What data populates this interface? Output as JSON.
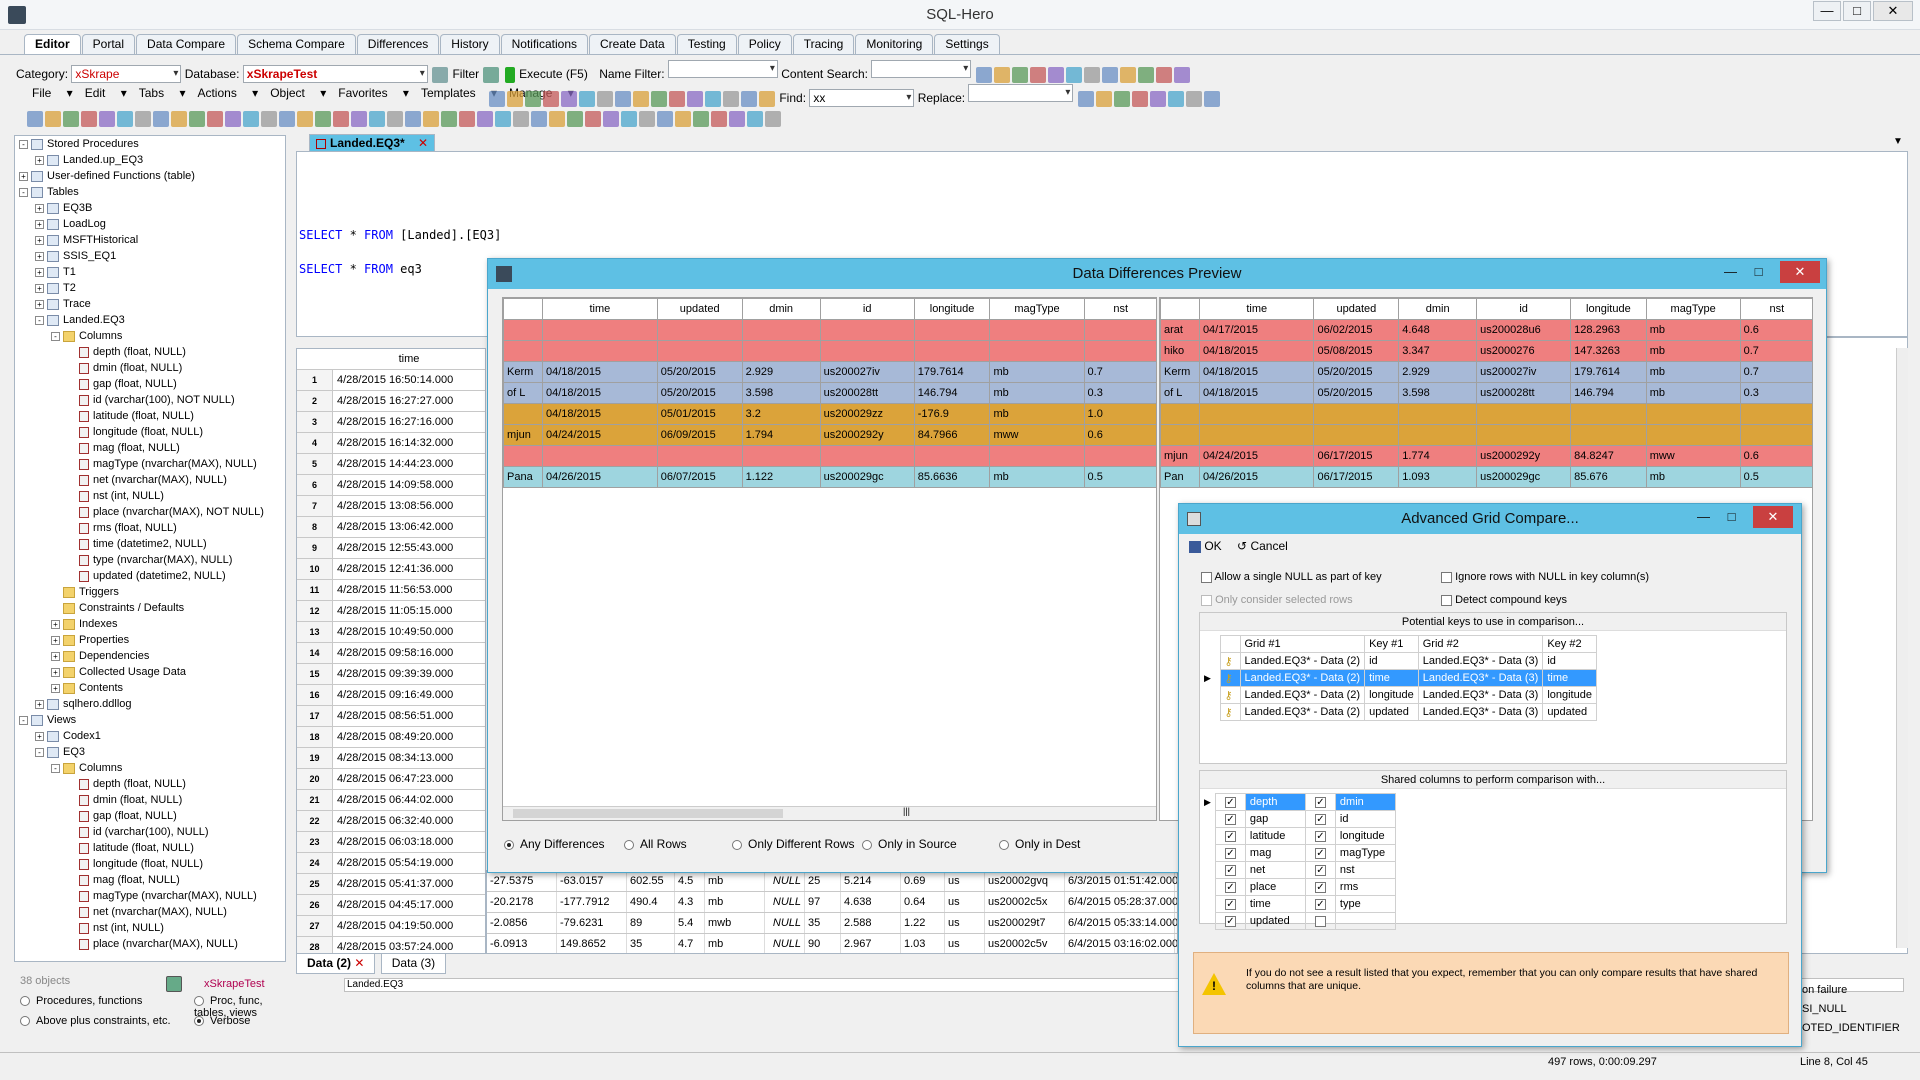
{
  "app": {
    "title": "SQL-Hero"
  },
  "tabs": [
    "Editor",
    "Portal",
    "Data Compare",
    "Schema Compare",
    "Differences",
    "History",
    "Notifications",
    "Create Data",
    "Testing",
    "Policy",
    "Tracing",
    "Monitoring",
    "Settings"
  ],
  "toolbar": {
    "category_label": "Category:",
    "category_value": "xSkrape",
    "database_label": "Database:",
    "database_value": "xSkrapeTest",
    "filter_label": "Filter",
    "execute_label": "Execute (F5)",
    "name_filter_label": "Name Filter:",
    "content_search_label": "Content Search:",
    "find_label": "Find:",
    "find_value": "xx",
    "replace_label": "Replace:"
  },
  "menu": [
    "File",
    "Edit",
    "Tabs",
    "Actions",
    "Object",
    "Favorites",
    "Templates",
    "Manage"
  ],
  "tree": [
    {
      "d": 0,
      "e": "-",
      "i": "db",
      "t": "Stored Procedures"
    },
    {
      "d": 1,
      "e": "+",
      "i": "db",
      "t": "Landed.up_EQ3"
    },
    {
      "d": 0,
      "e": "+",
      "i": "fx",
      "t": "User-defined Functions (table)"
    },
    {
      "d": 0,
      "e": "-",
      "i": "db",
      "t": "Tables"
    },
    {
      "d": 1,
      "e": "+",
      "i": "db",
      "t": "EQ3B"
    },
    {
      "d": 1,
      "e": "+",
      "i": "db",
      "t": "LoadLog"
    },
    {
      "d": 1,
      "e": "+",
      "i": "db",
      "t": "MSFTHistorical"
    },
    {
      "d": 1,
      "e": "+",
      "i": "db",
      "t": "SSIS_EQ1"
    },
    {
      "d": 1,
      "e": "+",
      "i": "db",
      "t": "T1"
    },
    {
      "d": 1,
      "e": "+",
      "i": "db",
      "t": "T2"
    },
    {
      "d": 1,
      "e": "+",
      "i": "db",
      "t": "Trace"
    },
    {
      "d": 1,
      "e": "-",
      "i": "db",
      "t": "Landed.EQ3"
    },
    {
      "d": 2,
      "e": "-",
      "i": "folder",
      "t": "Columns"
    },
    {
      "d": 3,
      "e": "",
      "i": "col",
      "t": "depth (float, NULL)"
    },
    {
      "d": 3,
      "e": "",
      "i": "col",
      "t": "dmin (float, NULL)"
    },
    {
      "d": 3,
      "e": "",
      "i": "col",
      "t": "gap (float, NULL)"
    },
    {
      "d": 3,
      "e": "",
      "i": "col",
      "t": "id (varchar(100), NOT NULL)"
    },
    {
      "d": 3,
      "e": "",
      "i": "col",
      "t": "latitude (float, NULL)"
    },
    {
      "d": 3,
      "e": "",
      "i": "col",
      "t": "longitude (float, NULL)"
    },
    {
      "d": 3,
      "e": "",
      "i": "col",
      "t": "mag (float, NULL)"
    },
    {
      "d": 3,
      "e": "",
      "i": "col",
      "t": "magType (nvarchar(MAX), NULL)"
    },
    {
      "d": 3,
      "e": "",
      "i": "col",
      "t": "net (nvarchar(MAX), NULL)"
    },
    {
      "d": 3,
      "e": "",
      "i": "col",
      "t": "nst (int, NULL)"
    },
    {
      "d": 3,
      "e": "",
      "i": "col",
      "t": "place (nvarchar(MAX), NOT NULL)"
    },
    {
      "d": 3,
      "e": "",
      "i": "col",
      "t": "rms (float, NULL)"
    },
    {
      "d": 3,
      "e": "",
      "i": "col",
      "t": "time (datetime2, NULL)"
    },
    {
      "d": 3,
      "e": "",
      "i": "col",
      "t": "type (nvarchar(MAX), NULL)"
    },
    {
      "d": 3,
      "e": "",
      "i": "col",
      "t": "updated (datetime2, NULL)"
    },
    {
      "d": 2,
      "e": "",
      "i": "folder",
      "t": "Triggers"
    },
    {
      "d": 2,
      "e": "",
      "i": "folder",
      "t": "Constraints / Defaults"
    },
    {
      "d": 2,
      "e": "+",
      "i": "folder",
      "t": "Indexes"
    },
    {
      "d": 2,
      "e": "+",
      "i": "folder",
      "t": "Properties"
    },
    {
      "d": 2,
      "e": "+",
      "i": "folder",
      "t": "Dependencies"
    },
    {
      "d": 2,
      "e": "+",
      "i": "folder",
      "t": "Collected Usage Data"
    },
    {
      "d": 2,
      "e": "+",
      "i": "folder",
      "t": "Contents"
    },
    {
      "d": 1,
      "e": "+",
      "i": "db",
      "t": "sqlhero.ddllog"
    },
    {
      "d": 0,
      "e": "-",
      "i": "db",
      "t": "Views"
    },
    {
      "d": 1,
      "e": "+",
      "i": "db",
      "t": "Codex1"
    },
    {
      "d": 1,
      "e": "-",
      "i": "db",
      "t": "EQ3"
    },
    {
      "d": 2,
      "e": "-",
      "i": "folder",
      "t": "Columns"
    },
    {
      "d": 3,
      "e": "",
      "i": "col",
      "t": "depth (float, NULL)"
    },
    {
      "d": 3,
      "e": "",
      "i": "col",
      "t": "dmin (float, NULL)"
    },
    {
      "d": 3,
      "e": "",
      "i": "col",
      "t": "gap (float, NULL)"
    },
    {
      "d": 3,
      "e": "",
      "i": "col",
      "t": "id (varchar(100), NULL)"
    },
    {
      "d": 3,
      "e": "",
      "i": "col",
      "t": "latitude (float, NULL)"
    },
    {
      "d": 3,
      "e": "",
      "i": "col",
      "t": "longitude (float, NULL)"
    },
    {
      "d": 3,
      "e": "",
      "i": "col",
      "t": "mag (float, NULL)"
    },
    {
      "d": 3,
      "e": "",
      "i": "col",
      "t": "magType (nvarchar(MAX), NULL)"
    },
    {
      "d": 3,
      "e": "",
      "i": "col",
      "t": "net (nvarchar(MAX), NULL)"
    },
    {
      "d": 3,
      "e": "",
      "i": "col",
      "t": "nst (int, NULL)"
    },
    {
      "d": 3,
      "e": "",
      "i": "col",
      "t": "place (nvarchar(MAX), NULL)"
    }
  ],
  "tree_footer": {
    "count": "38 objects",
    "db": "xSkrapeTest",
    "opt1": "Procedures, functions",
    "opt2": "Proc, func, tables, views",
    "opt3": "Above plus constraints, etc.",
    "opt4": "Verbose"
  },
  "editor": {
    "tab": "Landed.EQ3*",
    "line1_kw": "SELECT",
    "line1_rest": " * ",
    "line1_kw2": "FROM",
    "line1_obj": " [Landed].[EQ3]",
    "line2_kw": "SELECT",
    "line2_rest": " * ",
    "line2_kw2": "FROM",
    "line2_obj": " eq3"
  },
  "results": {
    "header": "time",
    "rows": [
      "4/28/2015 16:50:14.000",
      "4/28/2015 16:27:27.000",
      "4/28/2015 16:27:16.000",
      "4/28/2015 16:14:32.000",
      "4/28/2015 14:44:23.000",
      "4/28/2015 14:09:58.000",
      "4/28/2015 13:08:56.000",
      "4/28/2015 13:06:42.000",
      "4/28/2015 12:55:43.000",
      "4/28/2015 12:41:36.000",
      "4/28/2015 11:56:53.000",
      "4/28/2015 11:05:15.000",
      "4/28/2015 10:49:50.000",
      "4/28/2015 09:58:16.000",
      "4/28/2015 09:39:39.000",
      "4/28/2015 09:16:49.000",
      "4/28/2015 08:56:51.000",
      "4/28/2015 08:49:20.000",
      "4/28/2015 08:34:13.000",
      "4/28/2015 06:47:23.000",
      "4/28/2015 06:44:02.000",
      "4/28/2015 06:32:40.000",
      "4/28/2015 06:03:18.000",
      "4/28/2015 05:54:19.000",
      "4/28/2015 05:41:37.000",
      "4/28/2015 04:45:17.000",
      "4/28/2015 04:19:50.000",
      "4/28/2015 03:57:24.000"
    ],
    "extra": [
      [
        "-27.5375",
        "-63.0157",
        "602.55",
        "4.5",
        "mb",
        "NULL",
        "25",
        "5.214",
        "0.69",
        "us",
        "us20002gvq",
        "6/3/2015 01:51:42.000"
      ],
      [
        "-20.2178",
        "-177.7912",
        "490.4",
        "4.3",
        "mb",
        "NULL",
        "97",
        "4.638",
        "0.64",
        "us",
        "us20002c5x",
        "6/4/2015 05:28:37.000"
      ],
      [
        "-2.0856",
        "-79.6231",
        "89",
        "5.4",
        "mwb",
        "NULL",
        "35",
        "2.588",
        "1.22",
        "us",
        "us200029t7",
        "6/4/2015 05:33:14.000"
      ],
      [
        "-6.0913",
        "149.8652",
        "35",
        "4.7",
        "mb",
        "NULL",
        "90",
        "2.967",
        "1.03",
        "us",
        "us20002c5v",
        "6/4/2015 03:16:02.000"
      ]
    ],
    "tabs": [
      "Data (2)",
      "Data (3)"
    ],
    "source": "Landed.EQ3"
  },
  "diff": {
    "title": "Data Differences Preview",
    "left_cols": [
      "",
      "time",
      "updated",
      "dmin",
      "id",
      "longitude",
      "magType",
      "nst"
    ],
    "right_cols": [
      "",
      "time",
      "updated",
      "dmin",
      "id",
      "longitude",
      "magType",
      "nst"
    ],
    "rows": [
      {
        "c": "red",
        "l": [
          "",
          "",
          "",
          "",
          "",
          "",
          "",
          ""
        ],
        "r": [
          "arat",
          "04/17/2015",
          "06/02/2015",
          "4.648",
          "us200028u6",
          "128.2963",
          "mb",
          "0.6"
        ]
      },
      {
        "c": "red",
        "l": [
          "",
          "",
          "",
          "",
          "",
          "",
          "",
          ""
        ],
        "r": [
          "hiko",
          "04/18/2015",
          "05/08/2015",
          "3.347",
          "us2000276",
          "147.3263",
          "mb",
          "0.7"
        ]
      },
      {
        "c": "blue",
        "l": [
          "Kerm",
          "04/18/2015",
          "05/20/2015",
          "2.929",
          "us200027iv",
          "179.7614",
          "mb",
          "0.7"
        ],
        "r": [
          "Kerm",
          "04/18/2015",
          "05/20/2015",
          "2.929",
          "us200027iv",
          "179.7614",
          "mb",
          "0.7"
        ]
      },
      {
        "c": "blue",
        "l": [
          "of L",
          "04/18/2015",
          "05/20/2015",
          "3.598",
          "us200028tt",
          "146.794",
          "mb",
          "0.3"
        ],
        "r": [
          "of L",
          "04/18/2015",
          "05/20/2015",
          "3.598",
          "us200028tt",
          "146.794",
          "mb",
          "0.3"
        ]
      },
      {
        "c": "orange",
        "l": [
          "",
          "04/18/2015",
          "05/01/2015",
          "3.2",
          "us200029zz",
          "-176.9",
          "mb",
          "1.0"
        ],
        "r": [
          "",
          "",
          "",
          "",
          "",
          "",
          "",
          ""
        ]
      },
      {
        "c": "orange",
        "l": [
          "mjun",
          "04/24/2015",
          "06/09/2015",
          "1.794",
          "us2000292y",
          "84.7966",
          "mww",
          "0.6"
        ],
        "r": [
          "",
          "",
          "",
          "",
          "",
          "",
          "",
          ""
        ]
      },
      {
        "c": "red",
        "l": [
          "",
          "",
          "",
          "",
          "",
          "",
          "",
          ""
        ],
        "r": [
          "mjun",
          "04/24/2015",
          "06/17/2015",
          "1.774",
          "us2000292y",
          "84.8247",
          "mww",
          "0.6"
        ]
      },
      {
        "c": "cyan",
        "l": [
          "Pana",
          "04/26/2015",
          "06/07/2015",
          "1.122",
          "us200029gc",
          "85.6636",
          "mb",
          "0.5"
        ],
        "r": [
          "Pan",
          "04/26/2015",
          "06/17/2015",
          "1.093",
          "us200029gc",
          "85.676",
          "mb",
          "0.5"
        ]
      }
    ],
    "radios": [
      "Any Differences",
      "All Rows",
      "Only Different Rows",
      "Only in Source",
      "Only in Dest"
    ]
  },
  "agc": {
    "title": "Advanced Grid Compare...",
    "ok": "OK",
    "cancel": "Cancel",
    "opt1": "Allow a single NULL as part of key",
    "opt2": "Ignore rows with NULL in key column(s)",
    "opt3": "Only consider selected rows",
    "opt4": "Detect compound keys",
    "keys_title": "Potential keys to use in comparison...",
    "keys_cols": [
      "Grid #1",
      "Key #1",
      "Grid #2",
      "Key #2"
    ],
    "keys": [
      [
        "Landed.EQ3* - Data (2)",
        "id",
        "Landed.EQ3* - Data (3)",
        "id"
      ],
      [
        "Landed.EQ3* - Data (2)",
        "time",
        "Landed.EQ3* - Data (3)",
        "time"
      ],
      [
        "Landed.EQ3* - Data (2)",
        "longitude",
        "Landed.EQ3* - Data (3)",
        "longitude"
      ],
      [
        "Landed.EQ3* - Data (2)",
        "updated",
        "Landed.EQ3* - Data (3)",
        "updated"
      ]
    ],
    "shared_title": "Shared columns to perform comparison with...",
    "shared": [
      [
        "depth",
        "dmin"
      ],
      [
        "gap",
        "id"
      ],
      [
        "latitude",
        "longitude"
      ],
      [
        "mag",
        "magType"
      ],
      [
        "net",
        "nst"
      ],
      [
        "place",
        "rms"
      ],
      [
        "time",
        "type"
      ],
      [
        "updated",
        ""
      ]
    ],
    "warning": "If you do not see a result listed that you expect, remember that you can only compare results that have shared columns that are unique."
  },
  "right_text": [
    "on failure",
    "SI_NULL",
    "OTED_IDENTIFIER"
  ],
  "status": {
    "rows": "497 rows, 0:00:09.297",
    "pos": "Line 8, Col 45"
  }
}
